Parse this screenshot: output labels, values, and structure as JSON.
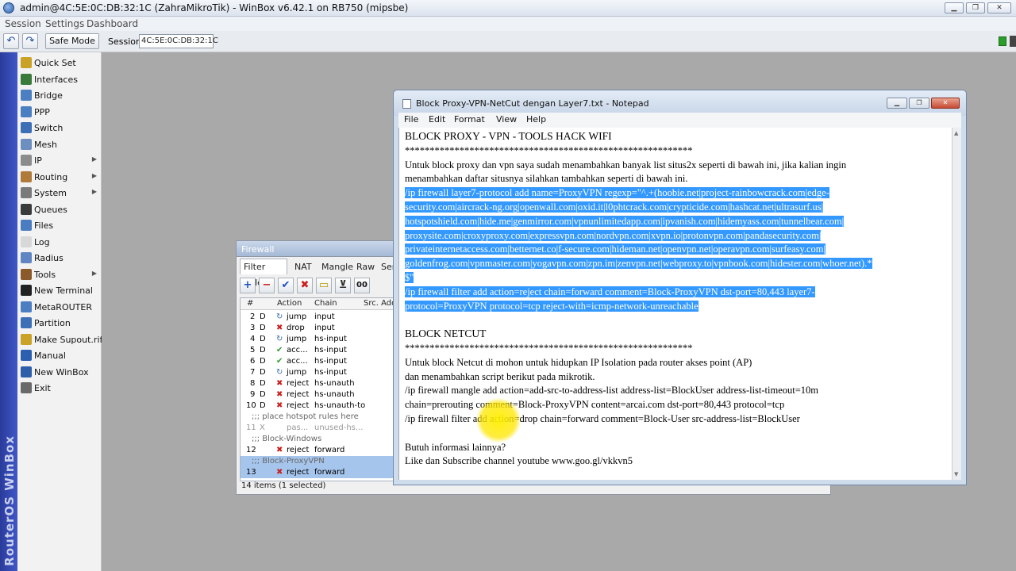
{
  "window": {
    "title": "admin@4C:5E:0C:DB:32:1C (ZahraMikroTik) - WinBox v6.42.1 on RB750 (mipsbe)"
  },
  "menubar": {
    "items": [
      "Session",
      "Settings",
      "Dashboard"
    ]
  },
  "toolbar": {
    "safe_mode": "Safe Mode",
    "session_label": "Session:",
    "session_value": "4C:5E:0C:DB:32:1C"
  },
  "sidebar": {
    "brand": "RouterOS WinBox",
    "items": [
      {
        "label": "Quick Set",
        "icon": "quick-set-icon",
        "color": "#c9a227",
        "submenu": false
      },
      {
        "label": "Interfaces",
        "icon": "interfaces-icon",
        "color": "#3a7a3a",
        "submenu": false
      },
      {
        "label": "Bridge",
        "icon": "bridge-icon",
        "color": "#4c7ec2",
        "submenu": false
      },
      {
        "label": "PPP",
        "icon": "ppp-icon",
        "color": "#4c7ec2",
        "submenu": false
      },
      {
        "label": "Switch",
        "icon": "switch-icon",
        "color": "#3d6fb6",
        "submenu": false
      },
      {
        "label": "Mesh",
        "icon": "mesh-icon",
        "color": "#6c8fbf",
        "submenu": false
      },
      {
        "label": "IP",
        "icon": "ip-icon",
        "color": "#8c8c8c",
        "submenu": true
      },
      {
        "label": "Routing",
        "icon": "routing-icon",
        "color": "#b07a3a",
        "submenu": true
      },
      {
        "label": "System",
        "icon": "system-icon",
        "color": "#7a7a7a",
        "submenu": true
      },
      {
        "label": "Queues",
        "icon": "queues-icon",
        "color": "#3b3b3b",
        "submenu": false
      },
      {
        "label": "Files",
        "icon": "files-icon",
        "color": "#4a7cc0",
        "submenu": false
      },
      {
        "label": "Log",
        "icon": "log-icon",
        "color": "#d8d8d8",
        "submenu": false
      },
      {
        "label": "Radius",
        "icon": "radius-icon",
        "color": "#5f86c2",
        "submenu": false
      },
      {
        "label": "Tools",
        "icon": "tools-icon",
        "color": "#8a5a2a",
        "submenu": true
      },
      {
        "label": "New Terminal",
        "icon": "terminal-icon",
        "color": "#222222",
        "submenu": false
      },
      {
        "label": "MetaROUTER",
        "icon": "metarouter-icon",
        "color": "#4c7ec2",
        "submenu": false
      },
      {
        "label": "Partition",
        "icon": "partition-icon",
        "color": "#3d6fb6",
        "submenu": false
      },
      {
        "label": "Make Supout.rif",
        "icon": "supout-icon",
        "color": "#c9a227",
        "submenu": false
      },
      {
        "label": "Manual",
        "icon": "manual-icon",
        "color": "#2b5fb0",
        "submenu": false
      },
      {
        "label": "New WinBox",
        "icon": "winbox-icon",
        "color": "#2f5fa8",
        "submenu": false
      },
      {
        "label": "Exit",
        "icon": "exit-icon",
        "color": "#6a6a6a",
        "submenu": false
      }
    ]
  },
  "firewall": {
    "title": "Firewall",
    "tabs": [
      "Filter Rules",
      "NAT",
      "Mangle",
      "Raw",
      "Serv"
    ],
    "tools": [
      {
        "label": "+",
        "icon": "add-icon",
        "color": "#1d4fc4"
      },
      {
        "label": "−",
        "icon": "remove-icon",
        "color": "#cc1f1f"
      },
      {
        "label": "✔",
        "icon": "enable-icon",
        "color": "#1d4fc4"
      },
      {
        "label": "✖",
        "icon": "disable-icon",
        "color": "#cc1f1f"
      },
      {
        "label": "▭",
        "icon": "comment-icon",
        "color": "#b89a00"
      },
      {
        "label": "⊻",
        "icon": "filter-icon",
        "color": "#333333"
      },
      {
        "label": "00",
        "icon": "reset-counters-icon",
        "color": "#111111"
      }
    ],
    "columns": [
      "#",
      "Action",
      "Chain",
      "Src. Addr"
    ],
    "rows": [
      {
        "num": "2",
        "flag": "D",
        "glyph": "↻",
        "kind": "jump",
        "action": "jump",
        "chain": "input"
      },
      {
        "num": "3",
        "flag": "D",
        "glyph": "✖",
        "kind": "drop",
        "action": "drop",
        "chain": "input"
      },
      {
        "num": "4",
        "flag": "D",
        "glyph": "↻",
        "kind": "jump",
        "action": "jump",
        "chain": "hs-input"
      },
      {
        "num": "5",
        "flag": "D",
        "glyph": "✔",
        "kind": "accept",
        "action": "acc...",
        "chain": "hs-input"
      },
      {
        "num": "6",
        "flag": "D",
        "glyph": "✔",
        "kind": "accept",
        "action": "acc...",
        "chain": "hs-input"
      },
      {
        "num": "7",
        "flag": "D",
        "glyph": "↻",
        "kind": "jump",
        "action": "jump",
        "chain": "hs-input"
      },
      {
        "num": "8",
        "flag": "D",
        "glyph": "✖",
        "kind": "reject",
        "action": "reject",
        "chain": "hs-unauth"
      },
      {
        "num": "9",
        "flag": "D",
        "glyph": "✖",
        "kind": "reject",
        "action": "reject",
        "chain": "hs-unauth"
      },
      {
        "num": "10",
        "flag": "D",
        "glyph": "✖",
        "kind": "reject",
        "action": "reject",
        "chain": "hs-unauth-to"
      },
      {
        "comment": ";;; place hotspot rules here",
        "kind": "comment"
      },
      {
        "num": "11",
        "flag": "X",
        "glyph": "",
        "kind": "disabled",
        "action": "pas...",
        "chain": "unused-hs..."
      },
      {
        "comment": ";;; Block-Windows",
        "kind": "comment"
      },
      {
        "num": "12",
        "flag": "",
        "glyph": "✖",
        "kind": "reject",
        "action": "reject",
        "chain": "forward"
      },
      {
        "comment": ";;; Block-ProxyVPN",
        "kind": "comment",
        "selected": true
      },
      {
        "num": "13",
        "flag": "",
        "glyph": "✖",
        "kind": "reject",
        "action": "reject",
        "chain": "forward",
        "selected": true
      }
    ],
    "status": "14 items (1 selected)"
  },
  "notepad": {
    "title": "Block Proxy-VPN-NetCut dengan Layer7.txt - Notepad",
    "menu": [
      "File",
      "Edit",
      "Format",
      "View",
      "Help"
    ],
    "lines": [
      {
        "text": "BLOCK PROXY - VPN - TOOLS HACK WIFI",
        "hl": false
      },
      {
        "text": "**********************************************************",
        "hl": false
      },
      {
        "text": "Untuk block proxy dan vpn saya sudah menambahkan banyak list situs2x seperti di bawah ini, jika kalian ingin",
        "hl": false
      },
      {
        "text": "menambahkan daftar situsnya silahkan tambahkan seperti di bawah ini.",
        "hl": false
      },
      {
        "text": "/ip firewall layer7-protocol add name=ProxyVPN regexp=\"^.+(hoobie.net|project-rainbowcrack.com|edge-",
        "hl": true
      },
      {
        "text": "security.com|aircrack-ng.org|openwall.com|oxid.it|l0phtcrack.com|crypticide.com|hashcat.net|ultrasurf.us|",
        "hl": true
      },
      {
        "text": "hotspotshield.com|hide.me|genmirror.com|vpnunlimitedapp.com|ipvanish.com|hidemyass.com|tunnelbear.com|",
        "hl": true
      },
      {
        "text": "proxysite.com|croxyproxy.com|expressvpn.com|nordvpn.com|xvpn.io|protonvpn.com|pandasecurity.com|",
        "hl": true
      },
      {
        "text": "privateinternetaccess.com|betternet.co|f-secure.com|hideman.net|openvpn.net|operavpn.com|surfeasy.com|",
        "hl": true
      },
      {
        "text": "goldenfrog.com|vpnmaster.com|yogavpn.com|zpn.im|zenvpn.net|webproxy.to|vpnbook.com|hidester.com|whoer.net).*",
        "hl": true
      },
      {
        "text": "$\"",
        "hl": true
      },
      {
        "text": "/ip firewall filter add action=reject chain=forward comment=Block-ProxyVPN dst-port=80,443 layer7-",
        "hl": true
      },
      {
        "text": "protocol=ProxyVPN protocol=tcp reject-with=icmp-network-unreachable",
        "hl": true
      },
      {
        "text": "",
        "hl": false
      },
      {
        "text": "BLOCK NETCUT",
        "hl": false
      },
      {
        "text": "**********************************************************",
        "hl": false
      },
      {
        "text": "Untuk block Netcut di mohon untuk hidupkan IP Isolation pada router akses point (AP)",
        "hl": false
      },
      {
        "text": "dan menambahkan script berikut pada mikrotik.",
        "hl": false
      },
      {
        "text": "/ip firewall mangle add action=add-src-to-address-list address-list=BlockUser address-list-timeout=10m",
        "hl": false
      },
      {
        "text": "chain=prerouting comment=Block-ProxyVPN content=arcai.com dst-port=80,443 protocol=tcp",
        "hl": false
      },
      {
        "text": "/ip firewall filter add action=drop chain=forward comment=Block-User src-address-list=BlockUser",
        "hl": false
      },
      {
        "text": "",
        "hl": false
      },
      {
        "text": "Butuh informasi lainnya?",
        "hl": false
      },
      {
        "text": "Like dan Subscribe channel youtube www.goo.gl/vkkvn5",
        "hl": false
      }
    ]
  },
  "colors": {
    "selection": "#3399ff",
    "reject": "#cc1f1f",
    "accept": "#2f9b2f",
    "jump": "#3a6db0",
    "sidebar_strip": "#3447b0"
  }
}
